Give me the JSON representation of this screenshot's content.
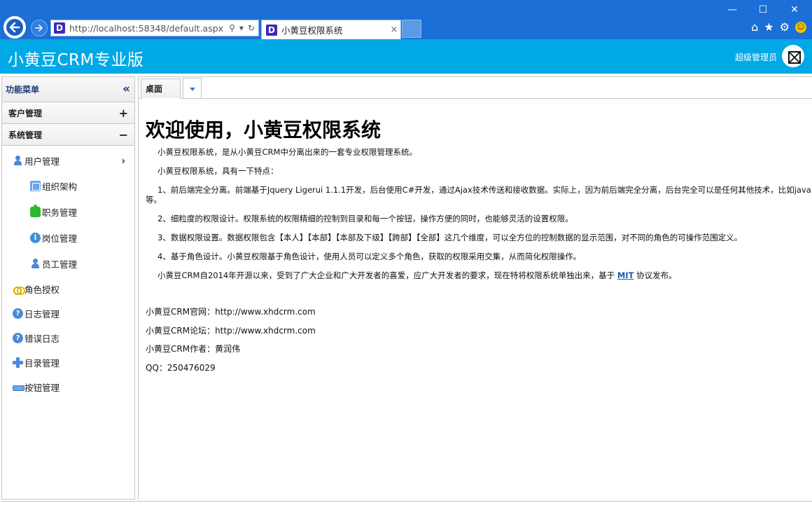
{
  "browser": {
    "url": "http://localhost:58348/default.aspx",
    "url_host": "localhost",
    "tab_title": "小黄豆权限系统",
    "site_icon_letter": "D",
    "tab_close": "×",
    "win_minimize": "—",
    "win_maximize": "☐",
    "win_close": "✕",
    "search_glyph": "⚲",
    "refresh_glyph": "↻",
    "dropdown_glyph": "▾",
    "toolbar_icons": [
      "home-icon",
      "star-icon",
      "gear-icon",
      "smiley-icon"
    ],
    "home_glyph": "⌂",
    "star_glyph": "★",
    "gear_glyph": "⚙",
    "smiley_glyph": "☺"
  },
  "header": {
    "app_title": "小黄豆CRM专业版",
    "user_name": "超级管理员",
    "bg_color": "#00a8e6"
  },
  "sidebar": {
    "title": "功能菜单",
    "collapse_glyph": "«",
    "groups": [
      {
        "label": "客户管理",
        "toggle": "+"
      },
      {
        "label": "系统管理",
        "toggle": "−"
      }
    ],
    "items": [
      {
        "label": "用户管理",
        "icon": "user-icon",
        "level": 1,
        "has_children": true
      },
      {
        "label": "组织架构",
        "icon": "org-icon",
        "level": 2
      },
      {
        "label": "职务管理",
        "icon": "puzzle-icon",
        "level": 2
      },
      {
        "label": "岗位管理",
        "icon": "info-icon",
        "level": 2
      },
      {
        "label": "员工管理",
        "icon": "user-icon",
        "level": 2
      },
      {
        "label": "角色授权",
        "icon": "role-icon",
        "level": 1
      },
      {
        "label": "日志管理",
        "icon": "help-icon",
        "level": 1
      },
      {
        "label": "错误日志",
        "icon": "help-icon",
        "level": 1
      },
      {
        "label": "目录管理",
        "icon": "plus-icon",
        "level": 1
      },
      {
        "label": "按钮管理",
        "icon": "button-icon",
        "level": 1
      }
    ]
  },
  "tabs": {
    "active": "桌面"
  },
  "content": {
    "heading": "欢迎使用，小黄豆权限系统",
    "paragraphs": [
      "小黄豆权限系统，是从小黄豆CRM中分离出来的一套专业权限管理系统。",
      "小黄豆权限系统，具有一下特点：",
      "1、前后端完全分离。前端基于Jquery Ligerui 1.1.1开发，后台使用C#开发，通过Ajax技术传送和接收数据。实际上，因为前后端完全分离，后台完全可以是任何其他技术，比如java等。",
      "2、细粒度的权限设计。权限系统的权限精细的控制到目录和每一个按钮，操作方便的同时，也能够灵活的设置权限。",
      "3、数据权限设置。数据权限包含【本人】【本部】【本部及下级】【跨部】【全部】这几个维度，可以全方位的控制数据的显示范围，对不同的角色的可操作范围定义。",
      "4、基于角色设计。小黄豆权限基于角色设计，使用人员可以定义多个角色，获取的权限采用交集，从而简化权限操作。"
    ],
    "last_para_before": "小黄豆CRM自2014年开源以来，受到了广大企业和广大开发者的喜爱，应广大开发者的要求，现在特将权限系统单独出来，基于 ",
    "last_para_link": "MIT",
    "last_para_after": " 协议发布。",
    "info": [
      "小黄豆CRM官网：http://www.xhdcrm.com",
      "小黄豆CRM论坛：http://www.xhdcrm.com",
      "小黄豆CRM作者：黄润伟",
      "QQ：250476029"
    ]
  }
}
